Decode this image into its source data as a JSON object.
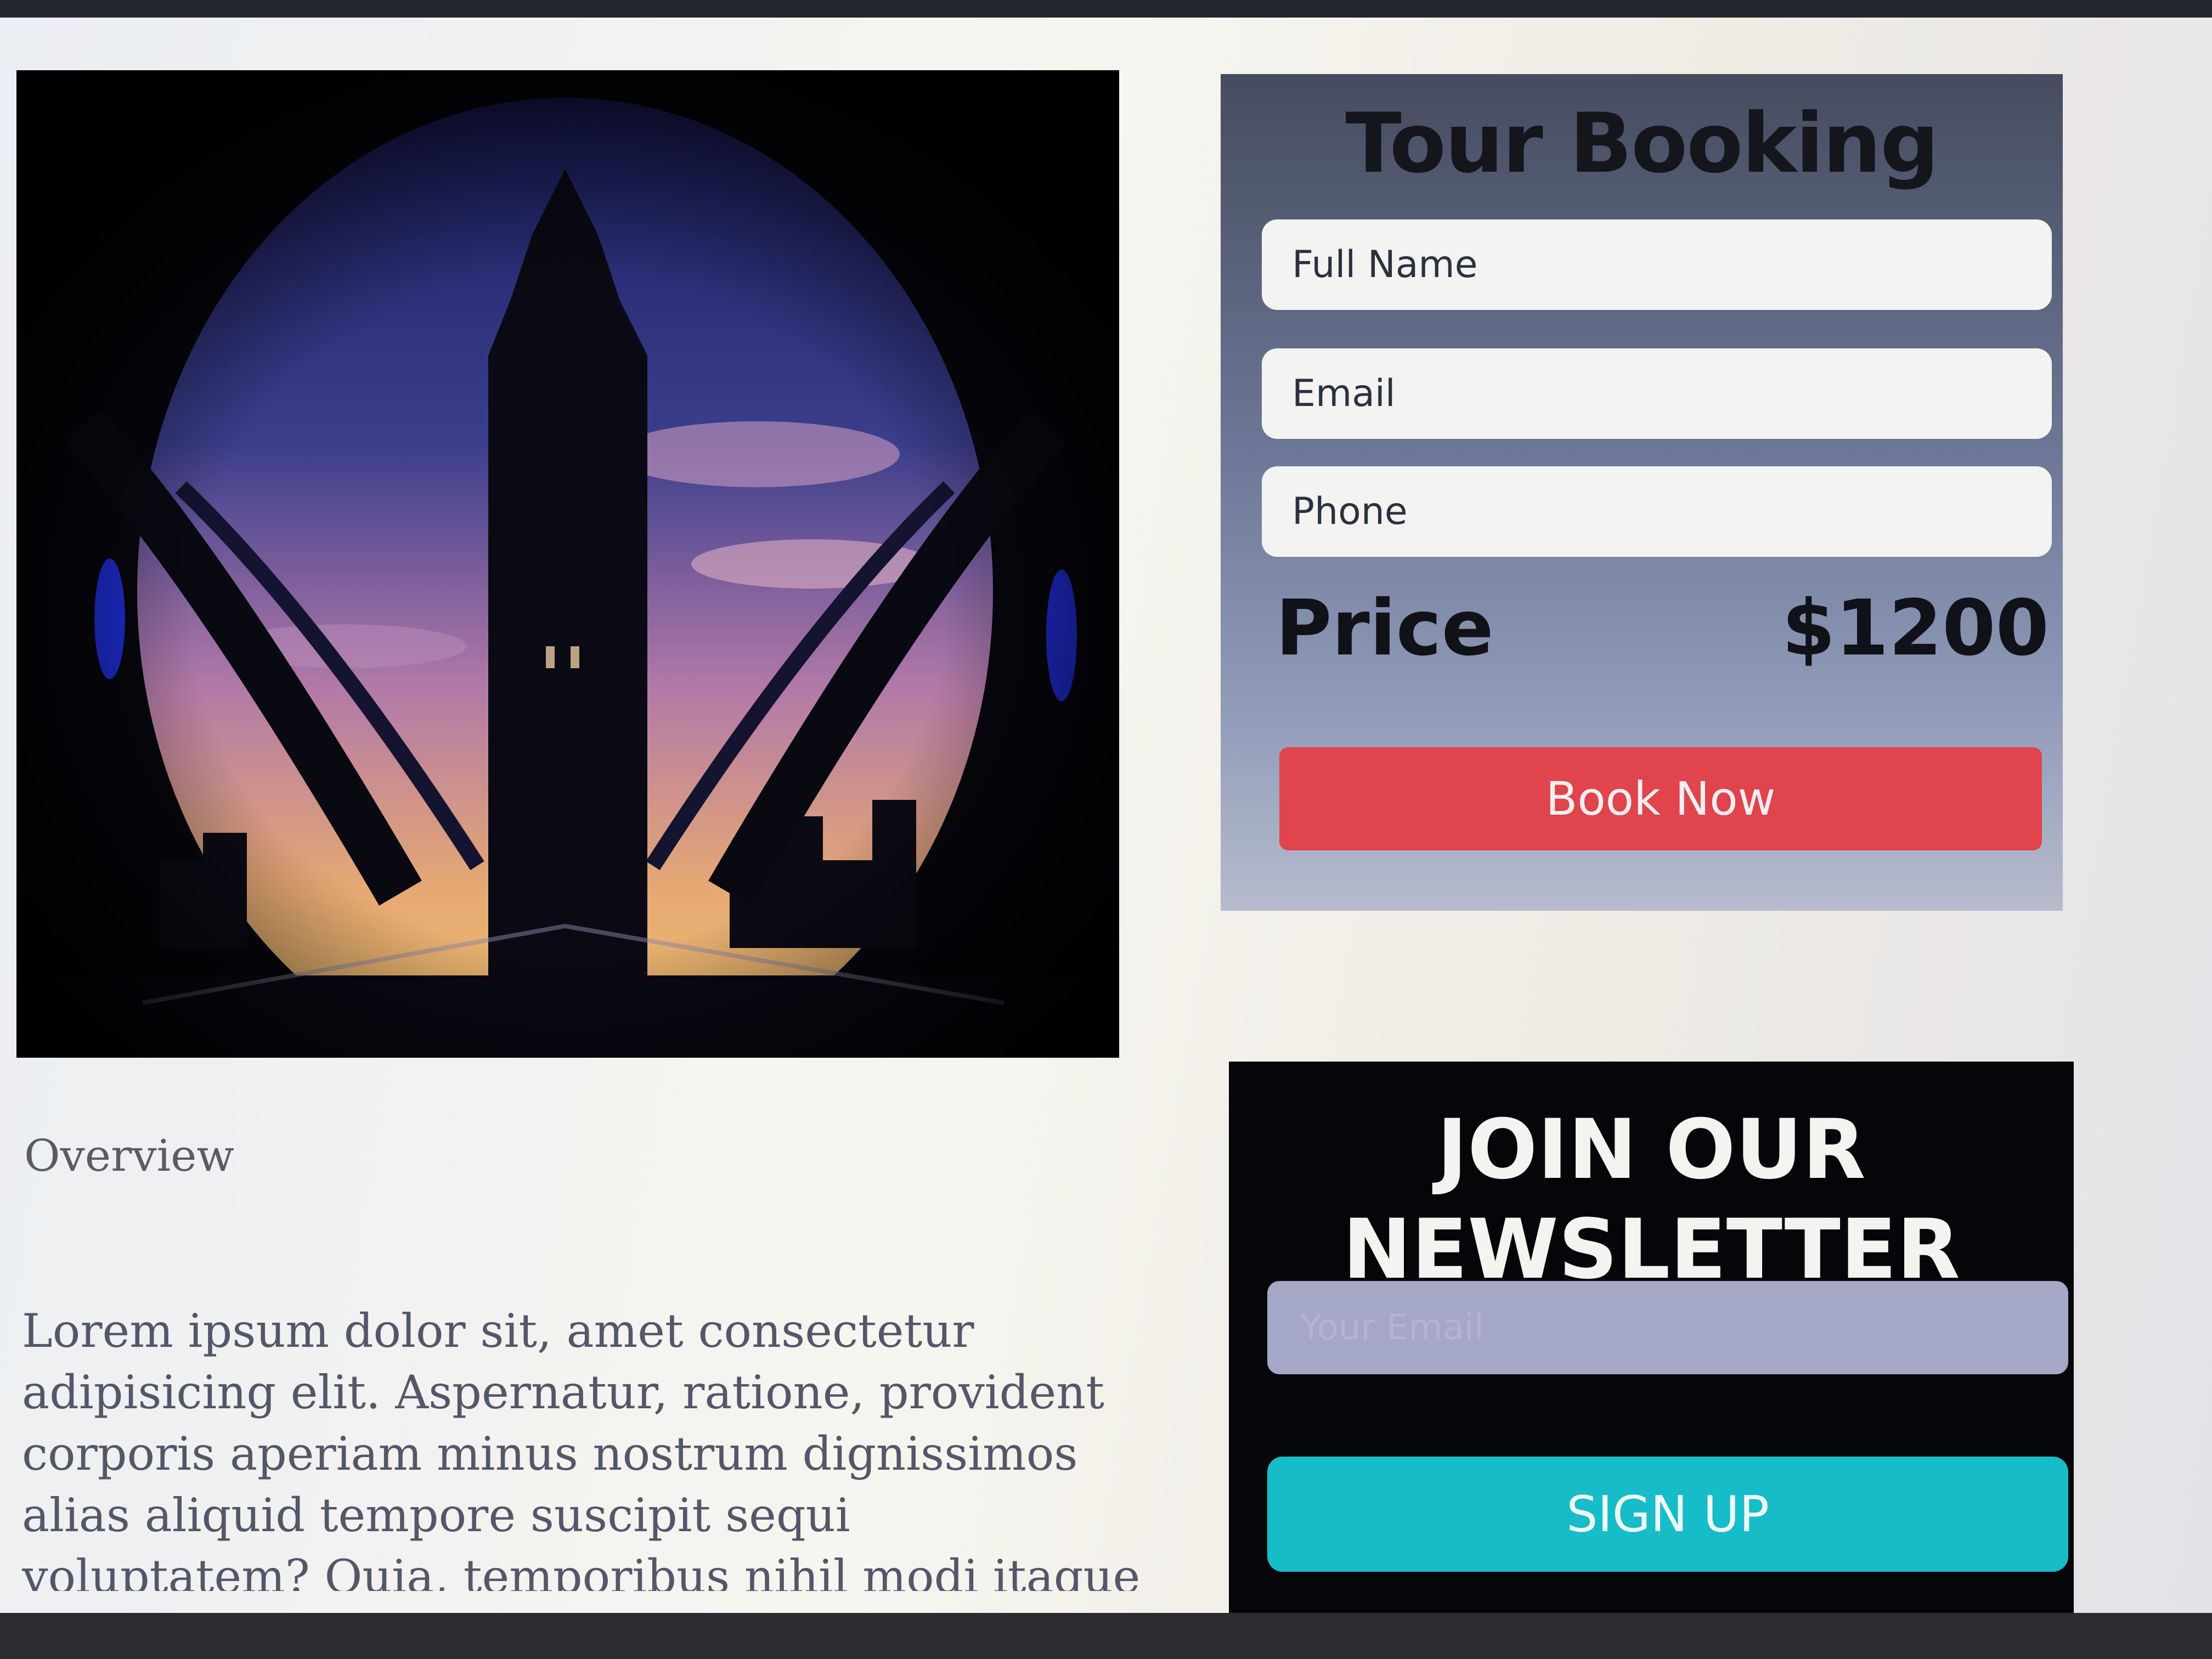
{
  "booking": {
    "title": "Tour Booking",
    "full_name_placeholder": "Full Name",
    "email_placeholder": "Email",
    "phone_placeholder": "Phone",
    "price_label": "Price",
    "price_value": "$1200",
    "book_button": "Book Now"
  },
  "content": {
    "overview_heading": "Overview",
    "body": "Lorem ipsum dolor sit, amet consectetur adipisicing elit. Aspernatur, ratione, provident corporis aperiam minus nostrum dignissimos alias aliquid tempore suscipit sequi voluptatem? Quia, temporibus nihil modi itaque sint incidunt nam id"
  },
  "newsletter": {
    "title_line1": "JOIN OUR",
    "title_line2": "NEWSLETTER",
    "email_placeholder": "Your Email",
    "signup_button": "SIGN UP"
  },
  "colors": {
    "book_button": "#e0444d",
    "signup_button": "#16bcc8",
    "newsletter_bg": "#05060a"
  }
}
